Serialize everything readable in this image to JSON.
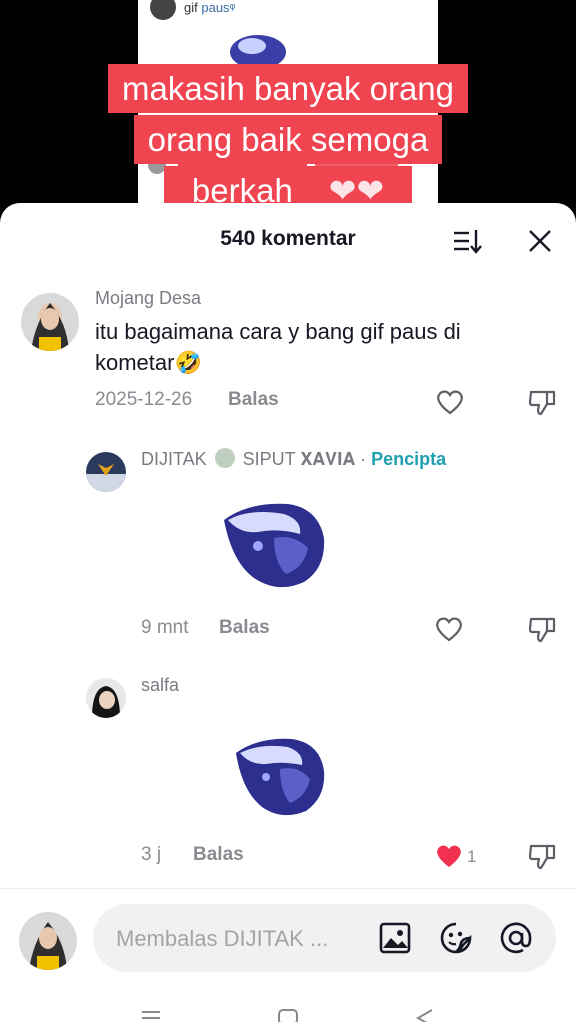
{
  "video": {
    "gif_label_prefix": "gif",
    "gif_label_link": "paus",
    "caption_line1": "makasih banyak orang",
    "caption_line2": "orang baik semoga",
    "caption_line3": "berkah"
  },
  "sheet": {
    "comment_count": "540 komentar"
  },
  "comments": [
    {
      "username": "Mojang Desa",
      "text": "itu bagaimana cara y bang gif paus di kometar🤣",
      "date": "2025-12-26",
      "reply_label": "Balas"
    },
    {
      "username": "DIJITAK",
      "username_suffix": "SIPUT 𝐗𝐀𝐕𝐈𝐀",
      "separator": "·",
      "creator_badge": "Pencipta",
      "date": "9 mnt",
      "reply_label": "Balas"
    },
    {
      "username": "salfa",
      "date": "3 j",
      "reply_label": "Balas",
      "like_count": "1"
    }
  ],
  "input": {
    "placeholder": "Membalas DIJITAK ..."
  },
  "colors": {
    "caption_bg": "#f04550",
    "creator": "#20a0b0",
    "liked_heart": "#f2304f"
  }
}
